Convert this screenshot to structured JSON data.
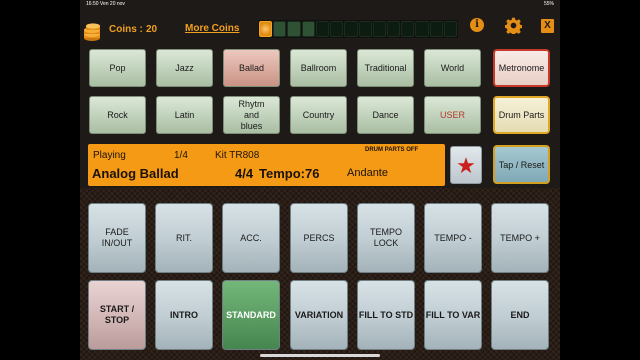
{
  "status_bar": {
    "time_date": "16:50  Ven 20 nov",
    "indicators": "55%"
  },
  "header": {
    "coins_label": "Coins :",
    "coins_value": "20",
    "more_coins": "More Coins",
    "info_icon": "i",
    "close_icon": "X",
    "progress_segments_total": 14,
    "progress_segments_on": 4
  },
  "styles": {
    "row1": [
      "Pop",
      "Jazz",
      "Ballad",
      "Ballroom",
      "Traditional",
      "World"
    ],
    "row2": [
      "Rock",
      "Latin",
      "Rhytm and blues",
      "Country",
      "Dance",
      "USER"
    ],
    "selected": "Ballad"
  },
  "side_buttons": {
    "metronome": "Metronome",
    "drum_parts": "Drum Parts",
    "tap_reset": "Tap / Reset"
  },
  "display": {
    "state": "Playing",
    "count": "1/4",
    "kit": "Kit TR808",
    "drum_parts_status": "DRUM PARTS OFF",
    "style_name": "Analog Ballad",
    "time_signature": "4/4",
    "tempo": "Tempo:76",
    "tempo_name": "Andante"
  },
  "favorite_icon": "star-icon",
  "pads": {
    "row1": [
      "FADE IN/OUT",
      "RIT.",
      "ACC.",
      "PERCS",
      "TEMPO LOCK",
      "TEMPO -",
      "TEMPO +"
    ],
    "row2": [
      "START / STOP",
      "INTRO",
      "STANDARD",
      "VARIATION",
      "FILL TO STD",
      "FILL TO VAR",
      "END"
    ]
  },
  "colors": {
    "accent": "#f59a15",
    "selected_style": "#d8a89c",
    "standard_pad": "#5a9c62",
    "background": "#1e1a18"
  }
}
